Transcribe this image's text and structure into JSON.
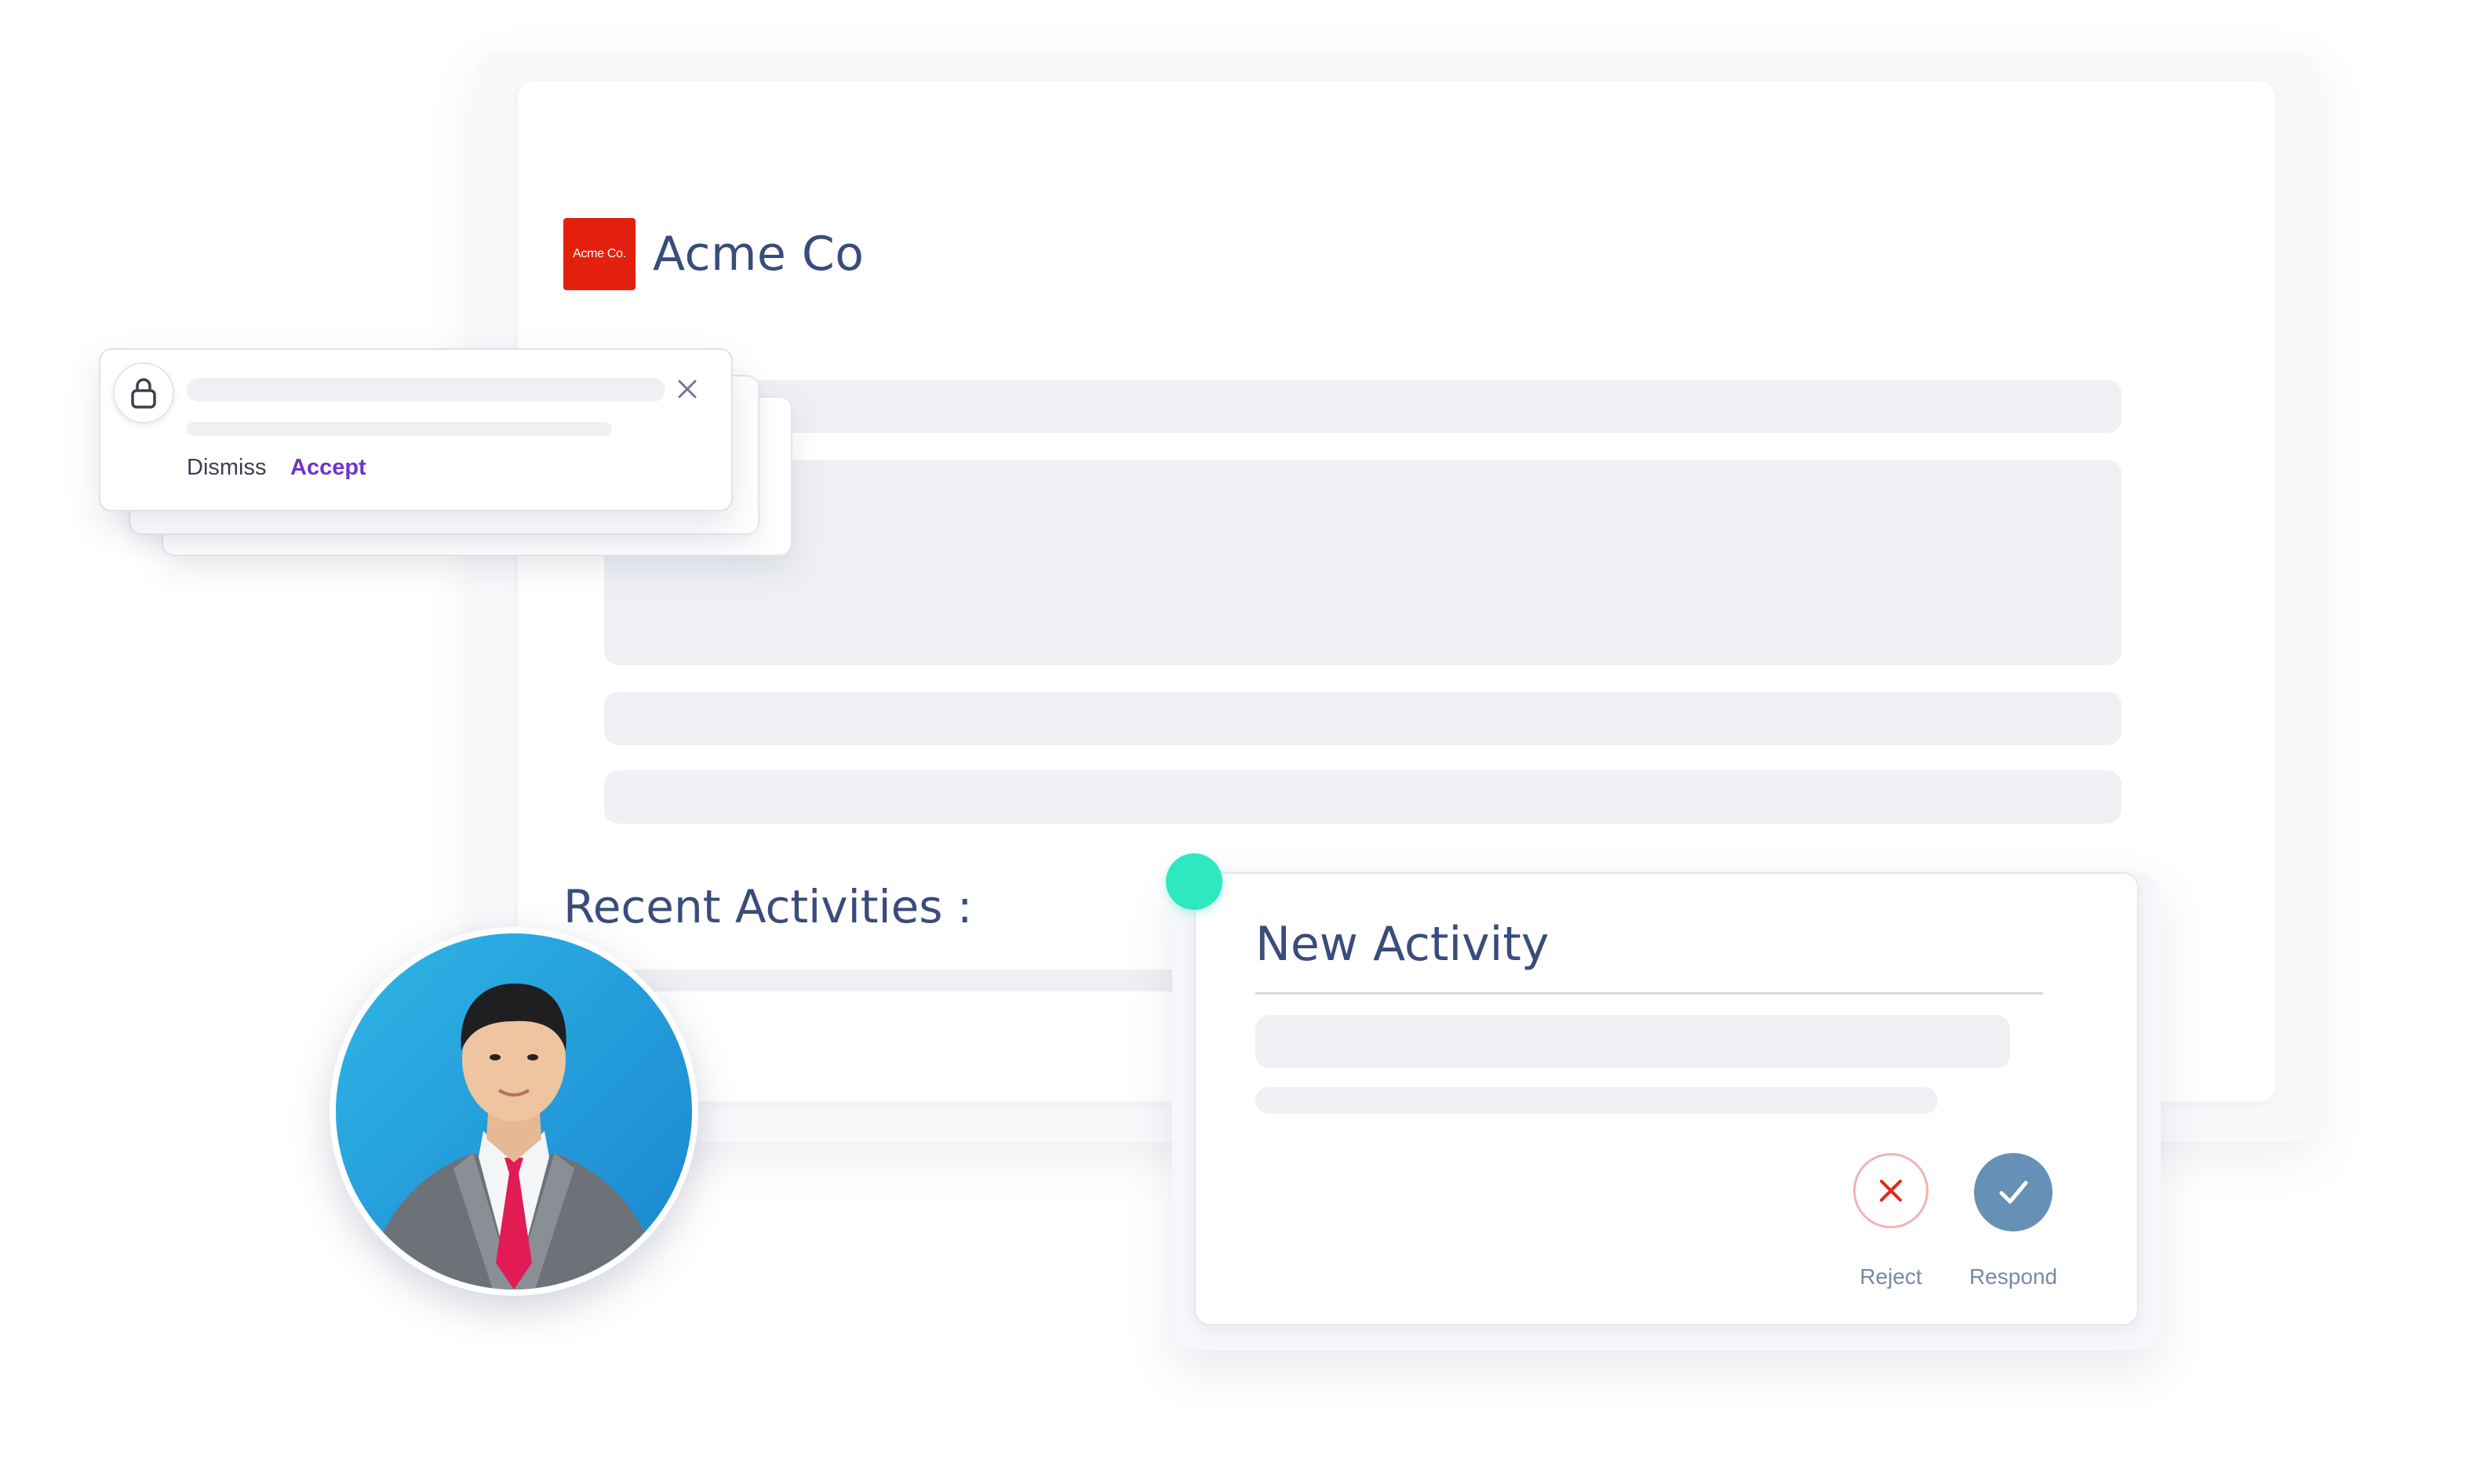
{
  "brand": {
    "logo_text": "Acme Co.",
    "name": "Acme Co",
    "logo_color": "#e3200d"
  },
  "main": {
    "section_title": "Recent Activities :"
  },
  "notification": {
    "icon": "lock-icon",
    "dismiss_label": "Dismiss",
    "accept_label": "Accept",
    "accept_color": "#6b37c9"
  },
  "activity_card": {
    "title": "New Activity",
    "reject_label": "Reject",
    "respond_label": "Respond",
    "reject_icon": "close-icon",
    "respond_icon": "checkmark-icon",
    "status_dot_color": "#2ee8c0",
    "respond_color": "#6690b6"
  },
  "colors": {
    "title_text": "#3a4c7c",
    "skeleton": "#eef0f4"
  }
}
